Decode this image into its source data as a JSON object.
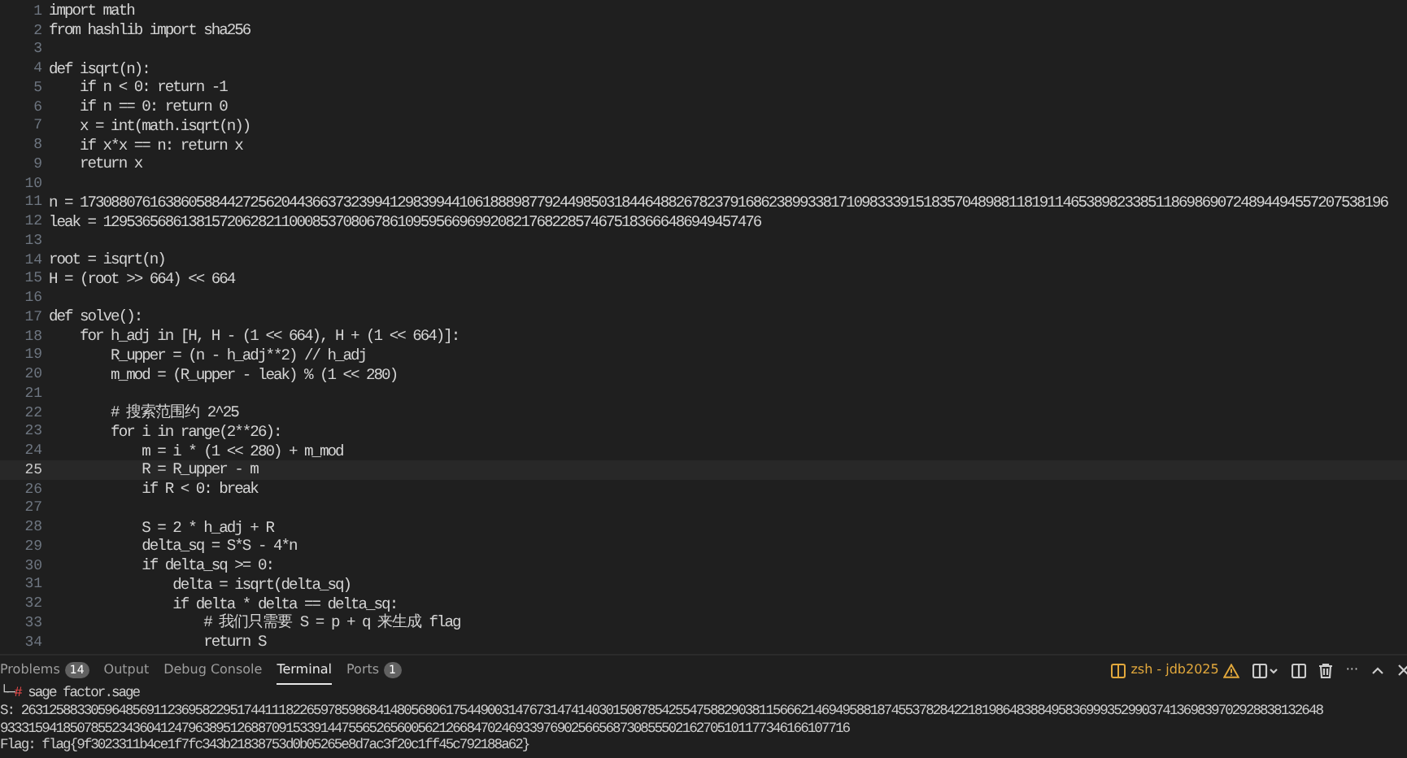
{
  "editor": {
    "lines": [
      {
        "number": "1",
        "text": "import math",
        "current": false
      },
      {
        "number": "2",
        "text": "from hashlib import sha256",
        "current": false
      },
      {
        "number": "3",
        "current": false
      },
      {
        "number": "4",
        "text": "def isqrt(n):",
        "current": false
      },
      {
        "number": "5",
        "text": "    if n < 0: return -1",
        "current": false
      },
      {
        "number": "6",
        "text": "    if n == 0: return 0",
        "current": false
      },
      {
        "number": "7",
        "text": "    x = int(math.isqrt(n))",
        "current": false
      },
      {
        "number": "8",
        "text": "    if x*x == n: return x",
        "current": false
      },
      {
        "number": "9",
        "text": "    return x",
        "current": false
      },
      {
        "number": "10",
        "current": false
      },
      {
        "number": "11",
        "text": "n = 1730880761638605884427256204436637323994129839944106188898779244985031844648826782379168623899338171098333915183570489881181911465389823385118698690724894494557207538196",
        "current": false
      },
      {
        "number": "12",
        "text": "leak = 1295365686138157206282110008537080678610959566969920821768228574675183666486949457476",
        "current": false
      },
      {
        "number": "13",
        "current": false
      },
      {
        "number": "14",
        "text": "root = isqrt(n)",
        "current": false
      },
      {
        "number": "15",
        "text": "H = (root >> 664) << 664",
        "current": false
      },
      {
        "number": "16",
        "current": false
      },
      {
        "number": "17",
        "text": "def solve():",
        "current": false
      },
      {
        "number": "18",
        "text": "    for h_adj in [H, H - (1 << 664), H + (1 << 664)]:",
        "current": false
      },
      {
        "number": "19",
        "text": "        R_upper = (n - h_adj**2) // h_adj",
        "current": false
      },
      {
        "number": "20",
        "text": "        m_mod = (R_upper - leak) % (1 << 280)",
        "current": false
      },
      {
        "number": "21",
        "current": false
      },
      {
        "number": "22",
        "text": "        # 搜索范围约 2^25",
        "current": false
      },
      {
        "number": "23",
        "text": "        for i in range(2**26):",
        "current": false
      },
      {
        "number": "24",
        "text": "            m = i * (1 << 280) + m_mod",
        "current": false
      },
      {
        "number": "25",
        "text": "            R = R_upper - m",
        "current": true
      },
      {
        "number": "26",
        "text": "            if R < 0: break",
        "current": false
      },
      {
        "number": "27",
        "current": false
      },
      {
        "number": "28",
        "text": "            S = 2 * h_adj + R",
        "current": false
      },
      {
        "number": "29",
        "text": "            delta_sq = S*S - 4*n",
        "current": false
      },
      {
        "number": "30",
        "text": "            if delta_sq >= 0:",
        "current": false
      },
      {
        "number": "31",
        "text": "                delta = isqrt(delta_sq)",
        "current": false
      },
      {
        "number": "32",
        "text": "                if delta * delta == delta_sq:",
        "current": false
      },
      {
        "number": "33",
        "text": "                    # 我们只需要 S = p + q 来生成 flag",
        "current": false
      },
      {
        "number": "34",
        "text": "                    return S",
        "current": false
      }
    ]
  },
  "panel": {
    "tabs": [
      {
        "label": "Problems",
        "count": "14",
        "selected": false
      },
      {
        "label": "Output",
        "selected": false
      },
      {
        "label": "Debug Console",
        "selected": false
      },
      {
        "label": "Terminal",
        "selected": true
      },
      {
        "label": "Ports",
        "count": "1",
        "selected": false
      }
    ],
    "terminal_name": "zsh - jdb2025",
    "more": "···",
    "terminal": {
      "prompt": "└─",
      "prompt_symbol": "#",
      "command": "sage factor.sage",
      "output": [
        "S: 2631258833059648569112369582295174411182265978598684148056806175449003147673147414030150878542554758829038115666214694958818745537828422181986483884958369993529903741369839702928838132648",
        "93331594185078552343604124796389512688709153391447556526560056212668470246933976902566568730855502162705101177346166107716",
        "Flag: flag{9f3023311b4ce1f7fc343b21838753d0b05265e8d7ac3f20c1ff45c792188a62}"
      ]
    }
  }
}
